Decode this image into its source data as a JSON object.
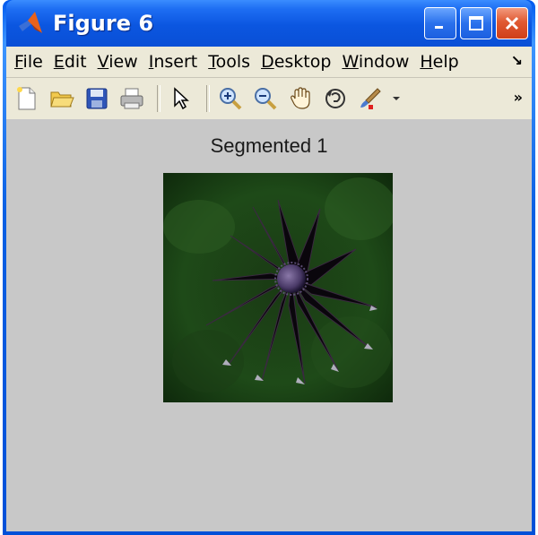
{
  "window": {
    "title": "Figure 6",
    "controls": [
      "minimize-icon",
      "maximize-icon",
      "close-icon"
    ]
  },
  "menu": {
    "items": [
      {
        "accel": "F",
        "rest": "ile"
      },
      {
        "accel": "E",
        "rest": "dit"
      },
      {
        "accel": "V",
        "rest": "iew"
      },
      {
        "accel": "I",
        "rest": "nsert"
      },
      {
        "accel": "T",
        "rest": "ools"
      },
      {
        "accel": "D",
        "rest": "esktop"
      },
      {
        "accel": "W",
        "rest": "indow"
      },
      {
        "accel": "H",
        "rest": "elp"
      }
    ],
    "overflow": "↘"
  },
  "toolbar": {
    "tools": [
      "new-figure-icon",
      "open-file-icon",
      "save-icon",
      "print-icon",
      "edit-plot-arrow-icon",
      "zoom-in-icon",
      "zoom-out-icon",
      "pan-hand-icon",
      "rotate-3d-icon",
      "brush-icon"
    ],
    "overflow": "»"
  },
  "figure": {
    "axes_title": "Segmented 1"
  },
  "colors": {
    "titlebar": "#0b56e0",
    "menubar": "#ece9d8",
    "figure_bg": "#c8c8c8"
  }
}
